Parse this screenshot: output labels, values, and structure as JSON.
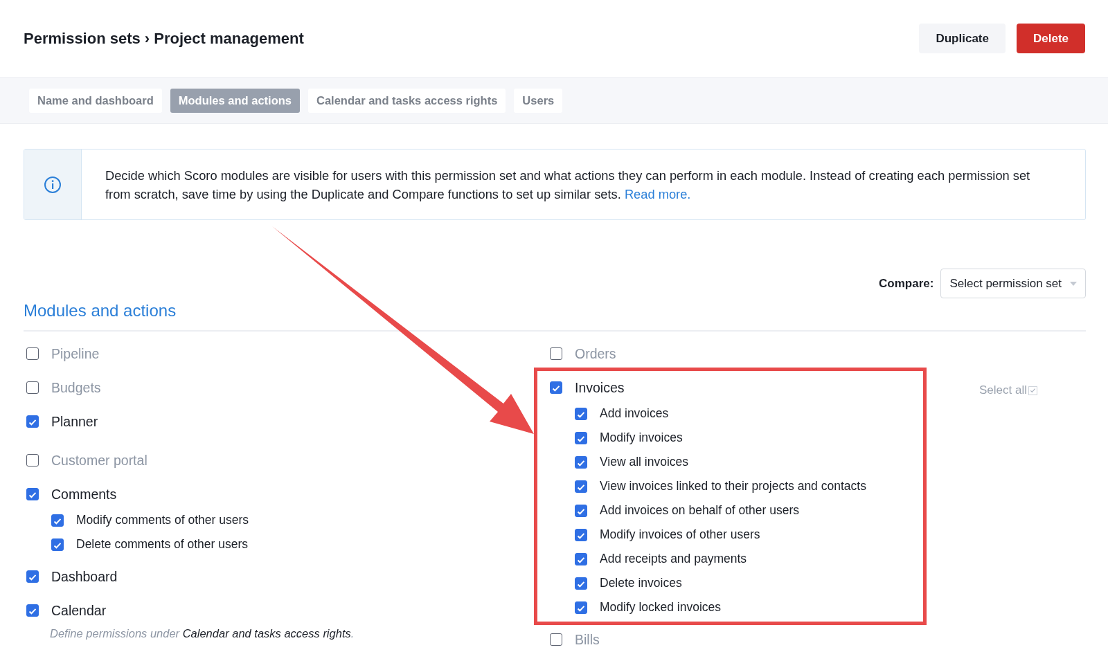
{
  "header": {
    "breadcrumb": "Permission sets › Project management",
    "buttons": [
      {
        "label": "Duplicate",
        "kind": "secondary"
      },
      {
        "label": "Delete",
        "kind": "danger"
      }
    ]
  },
  "tabs": [
    {
      "label": "Name and dashboard",
      "selected": false
    },
    {
      "label": "Modules and actions",
      "selected": true
    },
    {
      "label": "Calendar and tasks access rights",
      "selected": false
    },
    {
      "label": "Users",
      "selected": false
    }
  ],
  "info": {
    "text": "Decide which Scoro modules are visible for users with this permission set and what actions they can perform in each module. Instead of creating each permission set from scratch, save time by using the Duplicate and Compare functions to set up similar sets.",
    "link": "Read more."
  },
  "compare": {
    "label": "Compare:",
    "placeholder": "Select permission set"
  },
  "section_title": "Modules and actions",
  "left_modules": [
    {
      "label": "Pipeline",
      "checked": false
    },
    {
      "label": "Budgets",
      "checked": false
    },
    {
      "label": "Planner",
      "checked": true
    },
    {
      "label": "Customer portal",
      "checked": false
    },
    {
      "label": "Comments",
      "checked": true,
      "children": [
        {
          "label": "Modify comments of other users",
          "checked": true
        },
        {
          "label": "Delete comments of other users",
          "checked": true
        }
      ]
    },
    {
      "label": "Dashboard",
      "checked": true
    },
    {
      "label": "Calendar",
      "checked": true,
      "note": {
        "text": "Define permissions under",
        "link": "Calendar and tasks access rights",
        "suffix": "."
      }
    }
  ],
  "right_modules": [
    {
      "label": "Orders",
      "checked": false
    },
    {
      "label": "Invoices",
      "checked": true,
      "select_all": {
        "label": "Select all",
        "checked": true
      },
      "children": [
        {
          "label": "Add invoices",
          "checked": true
        },
        {
          "label": "Modify invoices",
          "checked": true
        },
        {
          "label": "View all invoices",
          "checked": true
        },
        {
          "label": "View invoices linked to their projects and contacts",
          "checked": true
        },
        {
          "label": "Add invoices on behalf of other users",
          "checked": true
        },
        {
          "label": "Modify invoices of other users",
          "checked": true
        },
        {
          "label": "Add receipts and payments",
          "checked": true
        },
        {
          "label": "Delete invoices",
          "checked": true
        },
        {
          "label": "Modify locked invoices",
          "checked": true
        }
      ]
    },
    {
      "label": "Bills",
      "checked": false
    }
  ]
}
